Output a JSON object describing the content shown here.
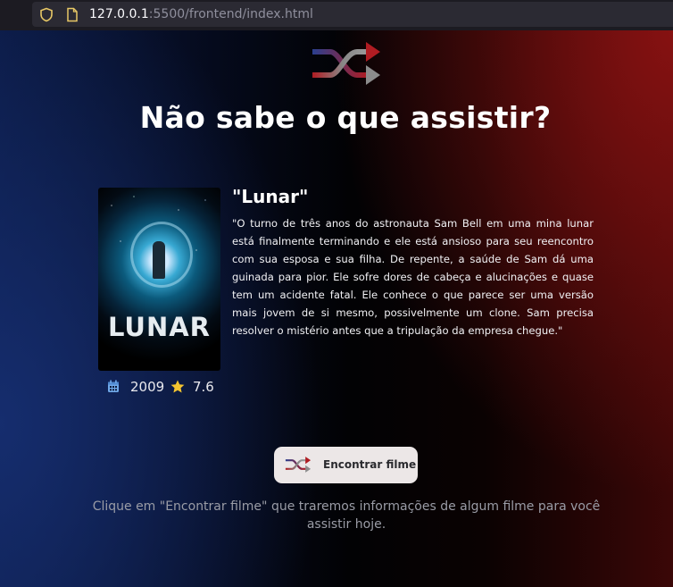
{
  "browser": {
    "url_host": "127.0.0.1",
    "url_rest": ":5500/frontend/index.html"
  },
  "page": {
    "logo_icon": "shuffle-icon",
    "headline": "Não sabe o que assistir?"
  },
  "movie": {
    "poster_title": "LUNAR",
    "title": "\"Lunar\"",
    "synopsis": "\"O turno de três anos do astronauta Sam Bell em uma mina lunar está finalmente terminando e ele está ansioso para seu reencontro com sua esposa e sua filha. De repente, a saúde de Sam dá uma guinada para pior. Ele sofre dores de cabeça e alucinações e quase tem um acidente fatal. Ele conhece o que parece ser uma versão mais jovem de si mesmo, possivelmente um clone. Sam precisa resolver o mistério antes que a tripulação da empresa chegue.\"",
    "year": "2009",
    "rating": "7.6",
    "year_icon": "calendar-icon",
    "rating_icon": "star-icon"
  },
  "actions": {
    "find_label": "Encontrar filme",
    "find_icon": "shuffle-icon"
  },
  "hint": "Clique em \"Encontrar filme\" que traremos informações de algum filme para você assistir hoje.",
  "colors": {
    "accent_red": "#8a1212",
    "accent_blue": "#162e70",
    "star": "#f4c430",
    "calendar": "#6fa8e8",
    "button_bg": "#ece7e7"
  }
}
